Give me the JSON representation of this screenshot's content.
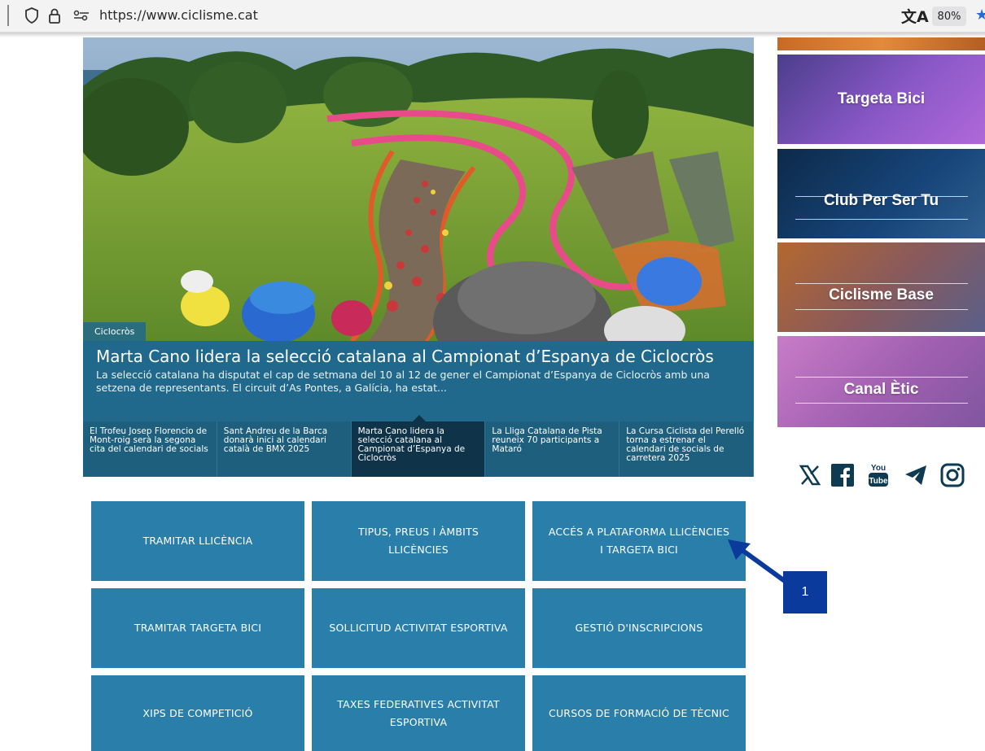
{
  "browser": {
    "url": "https://www.ciclisme.cat",
    "zoom": "80%",
    "translate_icon": "translate-icon",
    "star_icon": "bookmark-star-icon"
  },
  "hero": {
    "tag": "Ciclocròs",
    "title": "Marta Cano lidera la selecció catalana al Campionat d’Espanya de Ciclocròs",
    "summary": "La selecció catalana ha disputat el cap de setmana del 10 al 12 de gener el Campionat d’Espanya de Ciclocròs amb una setzena de representants. El circuit d’As Pontes, a Galícia, ha estat..."
  },
  "news": [
    {
      "text": "El Trofeu Josep Florencio de Mont-roig serà la segona cita del calendari de socials",
      "active": false
    },
    {
      "text": "Sant Andreu de la Barca donarà inici al calendari català de BMX 2025",
      "active": false
    },
    {
      "text": "Marta Cano lidera la selecció catalana al Campionat d’Espanya de Ciclocròs",
      "active": true
    },
    {
      "text": "La Lliga Catalana de Pista reuneix 70 participants a Mataró",
      "active": false
    },
    {
      "text": "La Cursa Ciclista del Perelló torna a estrenar el calendari de socials de carretera 2025",
      "active": false
    }
  ],
  "sidebar": {
    "banners": [
      "Targeta Bici",
      "Club Per Ser Tu",
      "Ciclisme Base",
      "Canal Ètic"
    ],
    "social_icons": [
      "x-icon",
      "facebook-icon",
      "youtube-icon",
      "telegram-icon",
      "instagram-icon"
    ]
  },
  "tiles": [
    "TRAMITAR LLICÈNCIA",
    "TIPUS, PREUS I ÀMBITS LLICÈNCIES",
    "ACCÉS A PLATAFORMA LLICÈNCIES I TARGETA BICI",
    "TRAMITAR TARGETA BICI",
    "SOLLICITUD ACTIVITAT ESPORTIVA",
    "GESTIÓ D'INSCRIPCIONS",
    "XIPS DE COMPETICIÓ",
    "TAXES FEDERATIVES ACTIVITAT ESPORTIVA",
    "CURSOS DE FORMACIÓ DE TÈCNIC"
  ],
  "annotation": {
    "label": "1",
    "color": "#0a3a9c"
  },
  "colors": {
    "tile": "#2a7faa",
    "caption": "#21698c",
    "news_strip": "#1f5f7e",
    "news_active": "#0f3348"
  }
}
